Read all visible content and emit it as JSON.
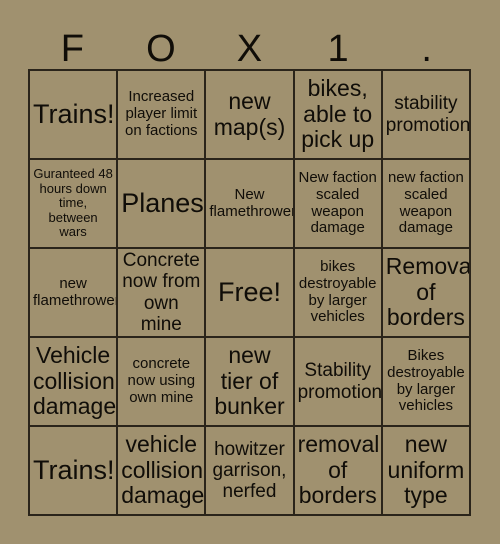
{
  "card": {
    "title_letters": [
      "F",
      "O",
      "X",
      "1",
      "."
    ],
    "background_color": "#a0916f",
    "border_color": "#2a241a",
    "text_color": "#100d08",
    "columns": 5,
    "rows": 5,
    "free_space_index": 12,
    "cells": [
      {
        "text": "Trains!",
        "size": "fs-xl"
      },
      {
        "text": "Increased player limit on factions",
        "size": "fs-sm"
      },
      {
        "text": "new map(s)",
        "size": "fs-lg"
      },
      {
        "text": "bikes, able to pick up",
        "size": "fs-lg"
      },
      {
        "text": "stability promotion",
        "size": "fs-md"
      },
      {
        "text": "Guranteed 48 hours down time, between wars",
        "size": "fs-xs"
      },
      {
        "text": "Planes!",
        "size": "fs-xl"
      },
      {
        "text": "New flamethrower",
        "size": "fs-sm"
      },
      {
        "text": "New faction scaled weapon damage",
        "size": "fs-sm"
      },
      {
        "text": "new faction scaled weapon damage",
        "size": "fs-sm"
      },
      {
        "text": "new flamethrower",
        "size": "fs-sm"
      },
      {
        "text": "Concrete now from own mine",
        "size": "fs-md"
      },
      {
        "text": "Free!",
        "size": "fs-xl"
      },
      {
        "text": "bikes destroyable by larger vehicles",
        "size": "fs-sm"
      },
      {
        "text": "Removal of borders",
        "size": "fs-lg"
      },
      {
        "text": "Vehicle collision damage",
        "size": "fs-lg"
      },
      {
        "text": "concrete now using own mine",
        "size": "fs-sm"
      },
      {
        "text": "new tier of bunker",
        "size": "fs-lg"
      },
      {
        "text": "Stability promotion",
        "size": "fs-md"
      },
      {
        "text": "Bikes destroyable by larger vehicles",
        "size": "fs-sm"
      },
      {
        "text": "Trains!",
        "size": "fs-xl"
      },
      {
        "text": "vehicle collision damage",
        "size": "fs-lg"
      },
      {
        "text": "howitzer garrison, nerfed",
        "size": "fs-md"
      },
      {
        "text": "removal of borders",
        "size": "fs-lg"
      },
      {
        "text": "new uniform type",
        "size": "fs-lg"
      }
    ]
  }
}
